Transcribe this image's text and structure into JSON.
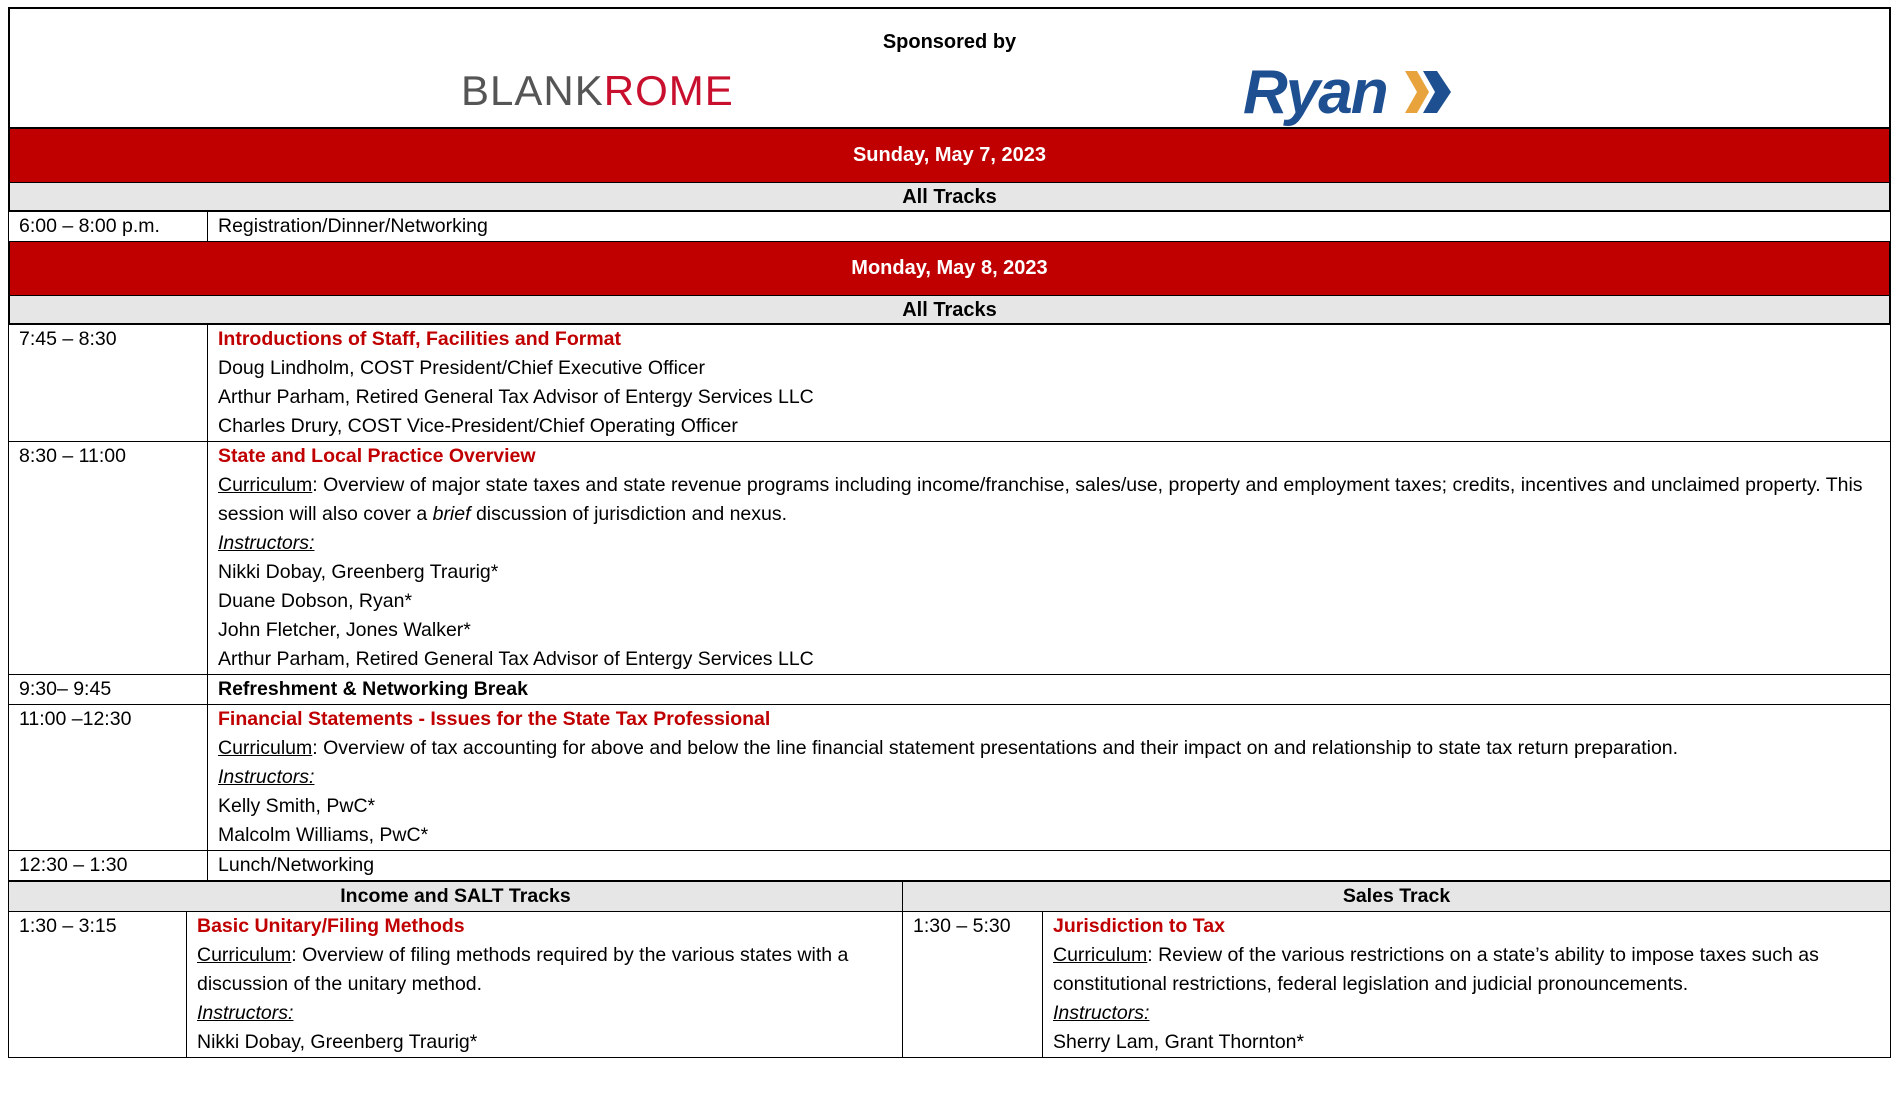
{
  "sponsor": {
    "label": "Sponsored by",
    "blank_text": "BLANK",
    "rome_text": "ROME",
    "ryan_text": "Ryan"
  },
  "colors": {
    "header_red": "#c00000",
    "title_red": "#c00000",
    "track_gray": "#e7e6e6"
  },
  "sunday": {
    "date": "Sunday, May 7, 2023",
    "track": "All Tracks",
    "rows": [
      {
        "time": "6:00 – 8:00 p.m.",
        "text": "Registration/Dinner/Networking"
      }
    ]
  },
  "monday": {
    "date": "Monday, May 8, 2023",
    "track": "All Tracks",
    "intro": {
      "time": "7:45 – 8:30",
      "title": "Introductions of Staff, Facilities and Format",
      "people": [
        "Doug Lindholm, COST President/Chief Executive Officer",
        "Arthur Parham, Retired General Tax Advisor of Entergy Services LLC",
        "Charles Drury, COST Vice-President/Chief Operating Officer"
      ]
    },
    "overview": {
      "time": "8:30 – 11:00",
      "title": "State and Local Practice Overview",
      "curriculum_label": "Curriculum",
      "curriculum_a": ":  Overview of major state taxes and state revenue programs including income/franchise, sales/use, property and employment taxes; credits, incentives and unclaimed property. This session will also cover a ",
      "curriculum_em": "brief",
      "curriculum_b": " discussion of jurisdiction and nexus.",
      "instructors_label": "Instructors:",
      "instructors": [
        "Nikki Dobay, Greenberg Traurig*",
        "Duane Dobson, Ryan*",
        "John Fletcher, Jones Walker*",
        "Arthur Parham, Retired General Tax Advisor of Entergy Services LLC"
      ]
    },
    "break": {
      "time": "9:30– 9:45",
      "text": "Refreshment & Networking Break"
    },
    "financial": {
      "time": "11:00 –12:30",
      "title": "Financial Statements - Issues for the State Tax Professional",
      "curriculum_label": "Curriculum",
      "curriculum": ":  Overview of tax accounting for above and below the line financial statement presentations and their impact on and relationship to state tax return preparation.",
      "instructors_label": "Instructors:",
      "instructors": [
        "Kelly Smith, PwC*",
        "Malcolm Williams, PwC*"
      ]
    },
    "lunch": {
      "time": "12:30 – 1:30",
      "text": "Lunch/Networking"
    },
    "tracks": {
      "left": "Income and SALT Tracks",
      "right": "Sales Track"
    },
    "unitary": {
      "time": "1:30 – 3:15",
      "title": "Basic Unitary/Filing Methods",
      "curriculum_label": "Curriculum",
      "curriculum": ":  Overview of filing methods required by the various states with a discussion of the unitary method.",
      "instructors_label": "Instructors:",
      "instructors": [
        "Nikki Dobay, Greenberg Traurig*"
      ]
    },
    "jurisdiction": {
      "time": "1:30 – 5:30",
      "title": "Jurisdiction to Tax",
      "curriculum_label": "Curriculum",
      "curriculum": ": Review of the various restrictions on a state’s ability to impose taxes such as constitutional restrictions, federal legislation and judicial pronouncements.",
      "instructors_label": "Instructors:",
      "instructors": [
        "Sherry Lam, Grant Thornton*"
      ]
    }
  }
}
